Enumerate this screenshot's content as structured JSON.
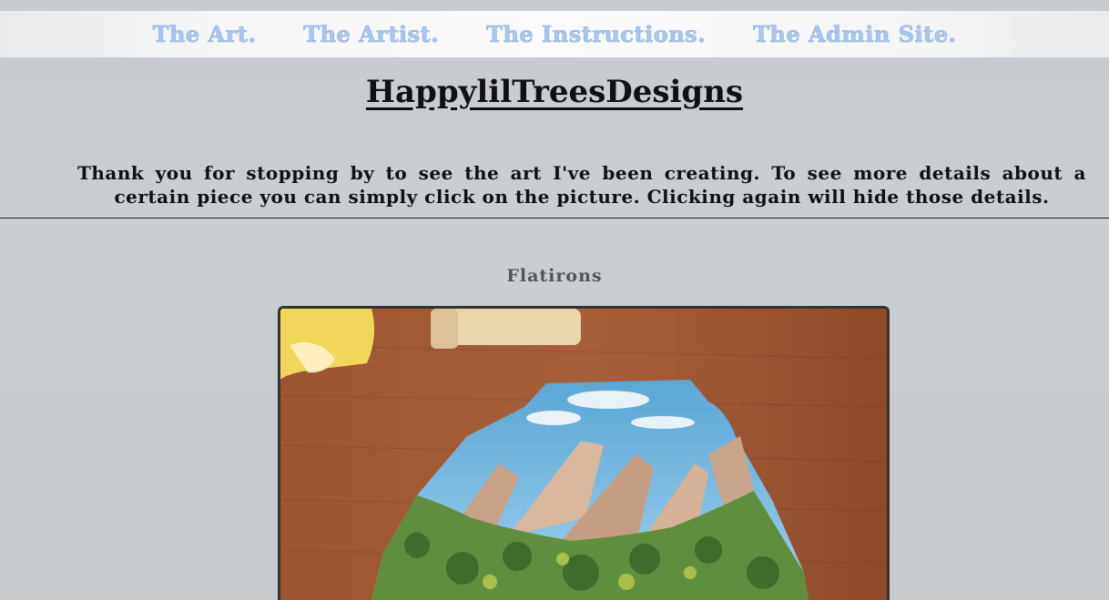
{
  "nav": {
    "items": [
      {
        "label": "The Art."
      },
      {
        "label": "The Artist."
      },
      {
        "label": "The Instructions."
      },
      {
        "label": "The Admin Site."
      }
    ]
  },
  "header": {
    "title": "HappylilTreesDesigns",
    "intro": "Thank you for stopping by to see the art I've been creating. To see more details about a certain piece you can simply click on the picture. Clicking again will hide those details."
  },
  "gallery": {
    "items": [
      {
        "title": "Flatirons"
      }
    ]
  },
  "colors": {
    "nav_link": "#a9c6ee",
    "background": "#c7ccd0",
    "text": "#111111"
  }
}
